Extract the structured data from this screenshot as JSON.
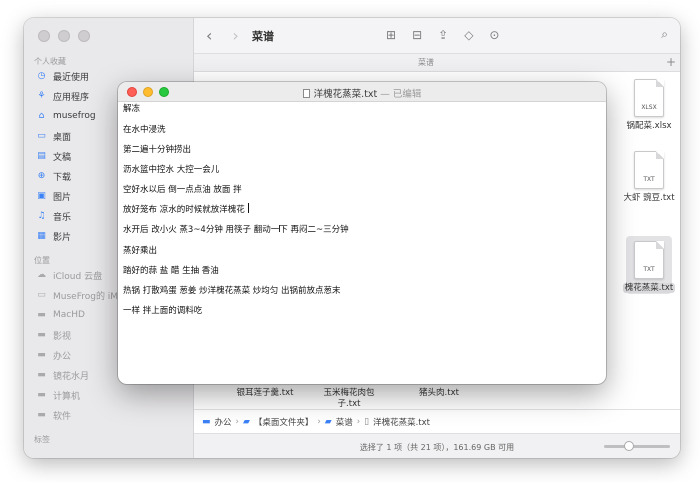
{
  "finder": {
    "title": "菜谱",
    "tab_label": "菜谱",
    "sidebar": {
      "favorites_header": "个人收藏",
      "favorites": [
        {
          "label": "最近使用",
          "icon": "clock-icon"
        },
        {
          "label": "应用程序",
          "icon": "apps-icon"
        },
        {
          "label": "musefrog",
          "icon": "home-icon"
        },
        {
          "label": "桌面",
          "icon": "desktop-icon"
        },
        {
          "label": "文稿",
          "icon": "document-icon"
        },
        {
          "label": "下载",
          "icon": "download-icon"
        },
        {
          "label": "图片",
          "icon": "photo-icon"
        },
        {
          "label": "音乐",
          "icon": "music-icon"
        },
        {
          "label": "影片",
          "icon": "movie-icon"
        }
      ],
      "locations_header": "位置",
      "locations": [
        {
          "label": "iCloud 云盘",
          "icon": "cloud-icon"
        },
        {
          "label": "MuseFrog的 iMac",
          "icon": "imac-icon"
        },
        {
          "label": "MacHD",
          "icon": "disk-icon"
        },
        {
          "label": "影视",
          "icon": "disk-icon"
        },
        {
          "label": "办公",
          "icon": "disk-icon"
        },
        {
          "label": "镜花水月",
          "icon": "disk-icon"
        },
        {
          "label": "计算机",
          "icon": "disk-icon"
        },
        {
          "label": "软件",
          "icon": "disk-icon"
        }
      ],
      "tags_header": "标签"
    },
    "files": [
      {
        "name": "锅配菜.xlsx",
        "type": "XLSX"
      },
      {
        "name": "大虾 豌豆.txt",
        "type": "TXT"
      },
      {
        "name": "槐花蒸菜.txt",
        "type": "TXT"
      }
    ],
    "bottom_names": {
      "col1": "银耳莲子羹.txt",
      "col2_line1": "玉米梅花肉包",
      "col2_line2": "子.txt",
      "col3": "猪头肉.txt"
    },
    "path": [
      "办公",
      "【桌面文件夹】",
      "菜谱",
      "洋槐花蒸菜.txt"
    ],
    "status": "选择了 1 项（共 21 项），161.69 GB 可用",
    "zoom_level": 0.35
  },
  "editor": {
    "filename": "洋槐花蒸菜.txt",
    "edited_label": "— 已编辑",
    "lines": [
      "解冻",
      "在水中浸洗",
      "第二遍十分钟捞出",
      "沥水篮中控水  大控一会儿",
      "空好水以后  倒一点点油  放面  拌",
      "放好笼布  凉水的时候就放洋槐花",
      "水开后  改小火  蒸3~4分钟  用筷子  翻动一下  再闷二~三分钟",
      "蒸好乘出",
      "踏好的蒜  盐  醋  生抽  香油",
      "热锅  打散鸡蛋  葱姜  炒洋槐花蒸菜  炒均匀  出锅前放点葱末",
      "一样  拌上面的调料吃"
    ]
  }
}
